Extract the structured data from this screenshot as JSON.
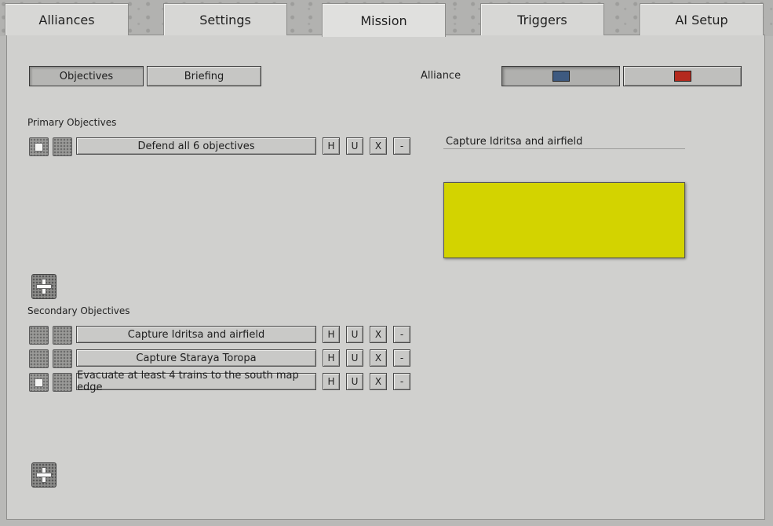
{
  "tabs": [
    {
      "label": "Alliances"
    },
    {
      "label": "Settings"
    },
    {
      "label": "Mission"
    },
    {
      "label": "Triggers"
    },
    {
      "label": "AI Setup"
    }
  ],
  "active_tab": "Mission",
  "view_toggle": {
    "objectives_label": "Objectives",
    "briefing_label": "Briefing",
    "selected": "Objectives"
  },
  "alliance": {
    "label": "Alliance",
    "options": [
      {
        "color": "#3e5a80",
        "selected": true
      },
      {
        "color": "#b52a1e",
        "selected": false
      }
    ]
  },
  "primary": {
    "heading": "Primary Objectives",
    "items": [
      {
        "label": "Defend all 6 objectives",
        "checked": true
      }
    ]
  },
  "secondary": {
    "heading": "Secondary Objectives",
    "items": [
      {
        "label": "Capture Idritsa and airfield",
        "checked": false
      },
      {
        "label": "Capture Staraya Toropa",
        "checked": false
      },
      {
        "label": "Evacuate at least 4 trains to the south map edge",
        "checked": true
      }
    ]
  },
  "row_buttons": {
    "h": "H",
    "u": "U",
    "x": "X",
    "remove": "-"
  },
  "detail": {
    "title": "Capture Idritsa and airfield",
    "color": "#d3d300"
  }
}
